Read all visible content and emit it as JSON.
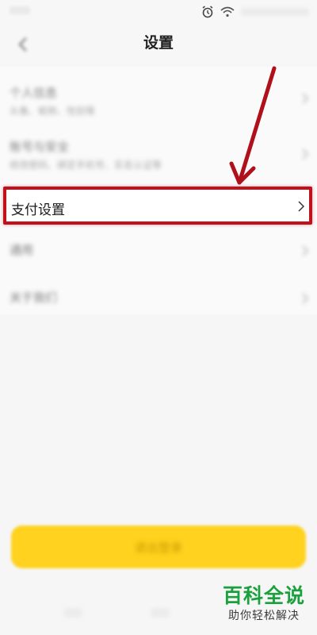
{
  "status_bar": {
    "icons": [
      "alarm-icon",
      "wifi-icon"
    ]
  },
  "header": {
    "title": "设置",
    "back_icon": "back-arrow-icon"
  },
  "settings": {
    "items": [
      {
        "title": "个人信息",
        "subtitle": "头像、昵称、性别等"
      },
      {
        "title": "账号与安全",
        "subtitle": "修改密码、绑定手机号、实名认证等"
      },
      {
        "title": "支付设置"
      },
      {
        "title": "通用"
      },
      {
        "title": "关于我们"
      }
    ]
  },
  "footer": {
    "logout_label": "退出登录"
  },
  "watermark": {
    "title": "百科全说",
    "subtitle": "助你轻松解决"
  },
  "colors": {
    "highlight": "#c1121c",
    "button": "#ffd21f",
    "watermark_green": "#1aa03c"
  }
}
